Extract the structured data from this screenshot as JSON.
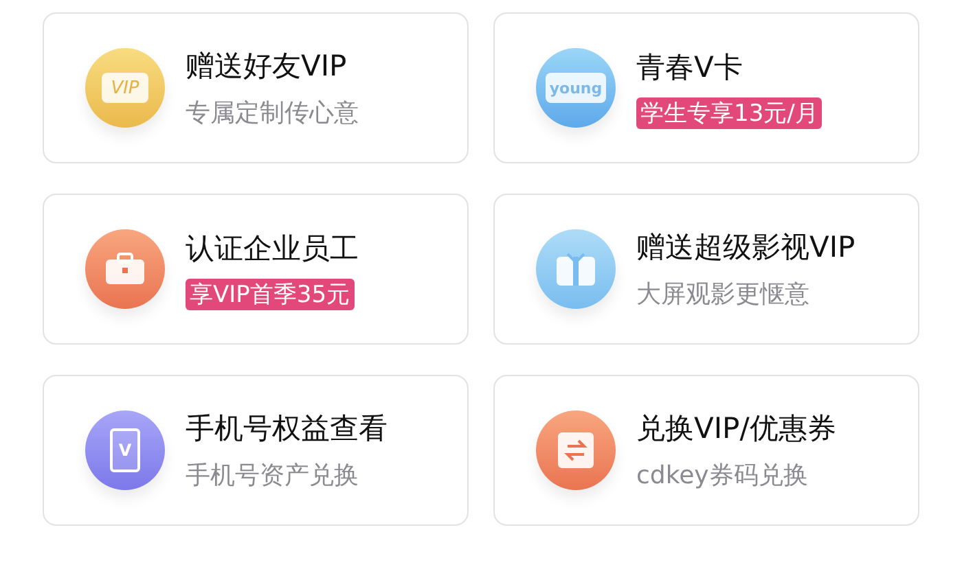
{
  "cards": [
    {
      "icon": {
        "kind": "vip",
        "text": "VIP"
      },
      "title": "赠送好友VIP",
      "subtitle": {
        "kind": "plain",
        "text": "专属定制传心意"
      }
    },
    {
      "icon": {
        "kind": "young",
        "text": "young"
      },
      "title": "青春V卡",
      "subtitle": {
        "kind": "badge",
        "text": "学生专享13元/月"
      }
    },
    {
      "icon": {
        "kind": "briefcase"
      },
      "title": "认证企业员工",
      "subtitle": {
        "kind": "badge",
        "text": "享VIP首季35元"
      }
    },
    {
      "icon": {
        "kind": "gift"
      },
      "title": "赠送超级影视VIP",
      "subtitle": {
        "kind": "plain",
        "text": "大屏观影更惬意"
      }
    },
    {
      "icon": {
        "kind": "phone",
        "text": "V"
      },
      "title": "手机号权益查看",
      "subtitle": {
        "kind": "plain",
        "text": "手机号资产兑换"
      }
    },
    {
      "icon": {
        "kind": "swap"
      },
      "title": "兑换VIP/优惠券",
      "subtitle": {
        "kind": "plain",
        "text": "cdkey券码兑换"
      }
    }
  ]
}
